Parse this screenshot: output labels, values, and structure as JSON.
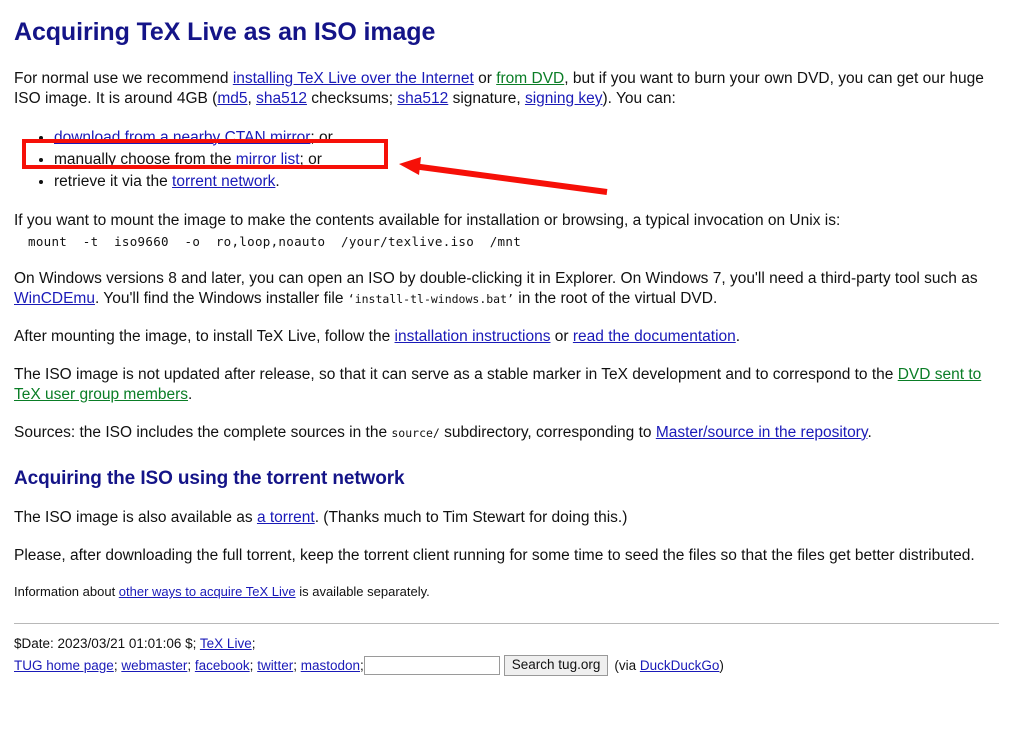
{
  "page": {
    "title": "Acquiring TeX Live as an ISO image",
    "intro": {
      "seg1": "For normal use we recommend ",
      "link_internet": "installing TeX Live over the Internet",
      "seg2": " or ",
      "link_from_dvd": "from DVD",
      "seg3": ", but if you want to burn your own DVD, you can get our huge ISO image. It is around 4GB (",
      "link_md5": "md5",
      "seg4": ", ",
      "link_sha512": "sha512",
      "seg5": " checksums; ",
      "link_sha512_sig": "sha512",
      "seg6": " signature, ",
      "link_signing_key": "signing key",
      "seg7": "). You can:"
    },
    "options": [
      {
        "link": "download from a nearby CTAN mirror",
        "tail": "; or"
      },
      {
        "prefix": "manually choose from the ",
        "link": "mirror list",
        "tail": "; or"
      },
      {
        "prefix": "retrieve it via the ",
        "link": "torrent network",
        "tail": "."
      }
    ],
    "mount_intro": "If you want to mount the image to make the contents available for installation or browsing, a typical invocation on Unix is:",
    "mount_command": "mount  -t  iso9660  -o  ro,loop,noauto  /your/texlive.iso  /mnt",
    "windows": {
      "seg1": "On Windows versions 8 and later, you can open an ISO by double-clicking it in Explorer. On Windows 7, you'll need a third-party tool such as ",
      "link_wincdemu": "WinCDEmu",
      "seg2": ". You'll find the Windows installer file ",
      "installer_file": "‘install-tl-windows.bat’",
      "seg3": " in the root of the virtual DVD."
    },
    "after_mount": {
      "seg1": "After mounting the image, to install TeX Live, follow the ",
      "link_install": "installation instructions",
      "seg2": " or ",
      "link_docs": "read the documentation",
      "seg3": "."
    },
    "not_updated": {
      "seg1": "The ISO image is not updated after release, so that it can serve as a stable marker in TeX development and to correspond to the ",
      "link_dvd_tug": "DVD sent to TeX user group members",
      "seg2": "."
    },
    "sources": {
      "seg1": "Sources: the ISO includes the complete sources in the ",
      "mono_source": "source/",
      "seg2": " subdirectory, corresponding to ",
      "link_master": "Master/source in the repository",
      "seg3": "."
    },
    "torrent_section": {
      "heading": "Acquiring the ISO using the torrent network",
      "p1_seg1": "The ISO image is also available as ",
      "p1_link": "a torrent",
      "p1_seg2": ". (Thanks much to Tim Stewart for doing this.)",
      "p2": "Please, after downloading the full torrent, keep the torrent client running for some time to seed the files so that the files get better distributed."
    },
    "other_ways": {
      "seg1": "Information about ",
      "link": "other ways to acquire TeX Live",
      "seg2": " is available separately."
    }
  },
  "footer": {
    "date_line_prefix": "$Date: 2023/03/21 01:01:06 $; ",
    "date_line_link": "TeX Live",
    "date_line_suffix": ";",
    "links": [
      {
        "label": "TUG home page",
        "sep": "; "
      },
      {
        "label": "webmaster",
        "sep": "; "
      },
      {
        "label": "facebook",
        "sep": "; "
      },
      {
        "label": "twitter",
        "sep": "; "
      },
      {
        "label": "mastodon",
        "sep": "; "
      }
    ],
    "search": {
      "value": "",
      "placeholder": "",
      "button_label": "Search tug.org",
      "via_prefix": "(via ",
      "via_link": "DuckDuckGo",
      "via_suffix": ")"
    }
  },
  "annotation": {
    "color": "#f61008",
    "box_label": "highlight-box-around-first-bullet",
    "arrow_label": "arrow-pointing-to-highlight-box"
  }
}
